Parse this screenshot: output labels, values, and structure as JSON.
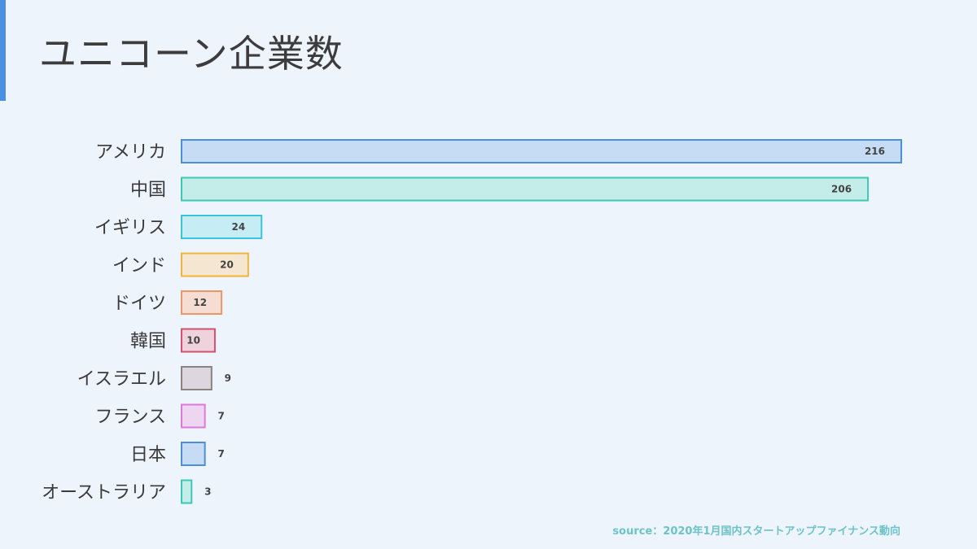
{
  "header": {
    "title": "ユニコーン企業数"
  },
  "footer": {
    "source": "source：2020年1月国内スタートアップファイナンス動向"
  },
  "chart_data": {
    "type": "bar",
    "orientation": "horizontal",
    "title": "ユニコーン企業数",
    "categories": [
      "アメリカ",
      "中国",
      "イギリス",
      "インド",
      "ドイツ",
      "韓国",
      "イスラエル",
      "フランス",
      "日本",
      "オーストラリア"
    ],
    "values": [
      216,
      206,
      24,
      20,
      12,
      10,
      9,
      7,
      7,
      3
    ],
    "value_labels": [
      "216",
      "206",
      "24",
      "20",
      "12",
      "10",
      "9",
      "7",
      "7",
      "3"
    ],
    "xlim": [
      0,
      216
    ],
    "grid": false,
    "legend": "none",
    "colors": {
      "strokes": [
        "#4a90d9",
        "#3cc8b4",
        "#3cc3dc",
        "#f0b43c",
        "#eb9664",
        "#d2506e",
        "#8c8282",
        "#dc78dc",
        "#4a90d9",
        "#3cc8b4"
      ],
      "fills": [
        "#c6dcf5",
        "#c4ede9",
        "#c6ecf4",
        "#f5e6d2",
        "#f5ddd3",
        "#eed2dc",
        "#dcd7de",
        "#efd6f0",
        "#c6dcf5",
        "#c4ede9"
      ]
    }
  }
}
